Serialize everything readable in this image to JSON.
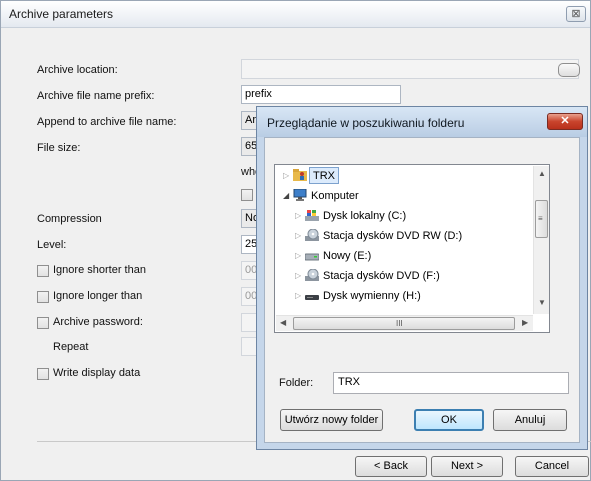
{
  "main": {
    "title": "Archive parameters",
    "close_glyph": "⊠",
    "labels": {
      "location": "Archive location:",
      "prefix": "Archive file name prefix:",
      "append": "Append to archive file name:",
      "size": "File size:",
      "compression": "Compression",
      "level": "Level:",
      "ignore_shorter": "Ignore shorter than",
      "ignore_longer": "Ignore longer than",
      "password": "Archive password:",
      "repeat": "Repeat",
      "display": "Write display data"
    },
    "values": {
      "location": "",
      "prefix": "prefix",
      "append": "Ar",
      "size": "65",
      "size_suffix": "whe",
      "compression": "No",
      "level": "25",
      "ignore_shorter": "00:",
      "ignore_longer": "00:"
    },
    "buttons": {
      "back": "< Back",
      "next": "Next >",
      "cancel": "Cancel"
    }
  },
  "folder_dialog": {
    "title": "Przeglądanie w poszukiwaniu folderu",
    "close_glyph": "✕",
    "tree": [
      {
        "label": "TRX",
        "icon": "user-folder-icon",
        "arrow": "▷",
        "selected": true
      },
      {
        "label": "Komputer",
        "icon": "computer-icon",
        "arrow": "◢"
      },
      {
        "label": "Dysk lokalny (C:)",
        "icon": "windows-drive-icon",
        "arrow": "▷"
      },
      {
        "label": "Stacja dysków DVD RW (D:)",
        "icon": "dvd-drive-icon",
        "arrow": "▷"
      },
      {
        "label": "Nowy (E:)",
        "icon": "drive-icon",
        "arrow": "▷"
      },
      {
        "label": "Stacja dysków DVD (F:)",
        "icon": "dvd-drive-icon",
        "arrow": "▷"
      },
      {
        "label": "Dysk wymienny (H:)",
        "icon": "removable-drive-icon",
        "arrow": "▷"
      }
    ],
    "scroll_grip": "≡",
    "hscroll_grip": "III",
    "folder_label": "Folder:",
    "folder_value": "TRX",
    "buttons": {
      "new_folder": "Utwórz nowy folder",
      "ok": "OK",
      "cancel": "Anuluj"
    }
  }
}
